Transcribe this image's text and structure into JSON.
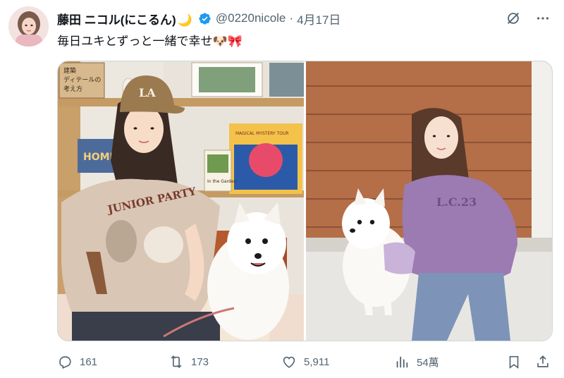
{
  "user": {
    "display_name": "藤田 ニコル(にこるん)",
    "name_emoji": "🌙",
    "handle": "@0220nicole",
    "separator": "·",
    "date": "4月17日"
  },
  "tweet": {
    "text": "毎日ユキとずっと一緒で幸せ🐶🎀"
  },
  "media": {
    "left_photo": {
      "book_sign": "建築\nディテールの\n考え方",
      "cap_logo": "LA",
      "shirt_text": "JUNIOR PARTY",
      "album_title": "MAGICAL MYSTERY TOUR",
      "book_title": "In the Garden",
      "home_book": "HOME"
    },
    "right_photo": {
      "shirt_text": "L.C.23"
    }
  },
  "actions": {
    "replies": "161",
    "retweets": "173",
    "likes": "5,911",
    "views": "54萬"
  },
  "colors": {
    "text": "#0f1419",
    "secondary": "#536471",
    "verified": "#1d9bf0"
  },
  "icons": [
    "grok-icon",
    "more-icon",
    "reply-icon",
    "retweet-icon",
    "like-icon",
    "views-icon",
    "bookmark-icon",
    "share-icon",
    "verified-badge-icon"
  ]
}
